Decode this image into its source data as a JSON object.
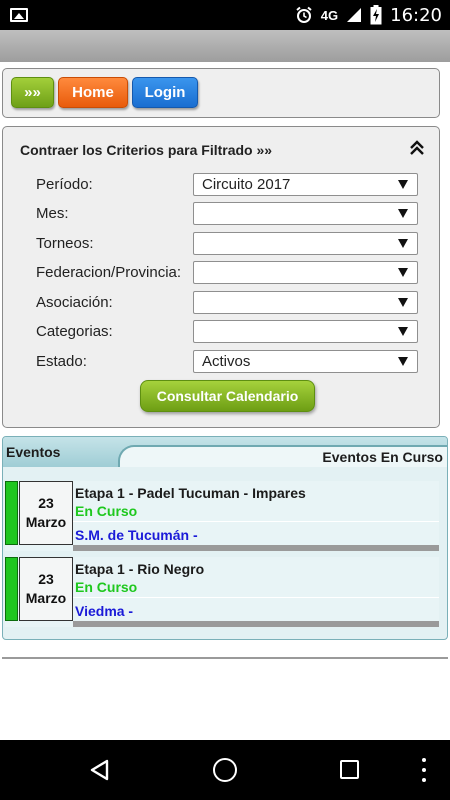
{
  "status_bar": {
    "network": "4G",
    "time": "16:20",
    "icons": [
      "image-icon",
      "alarm-icon",
      "signal-icon",
      "battery-charging-icon"
    ]
  },
  "nav": {
    "more_label": "»»",
    "home_label": "Home",
    "login_label": "Login"
  },
  "filter": {
    "title": "Contraer los Criterios para Filtrado »»",
    "fields": [
      {
        "label": "Período:",
        "value": "Circuito 2017"
      },
      {
        "label": "Mes:",
        "value": ""
      },
      {
        "label": "Torneos:",
        "value": ""
      },
      {
        "label": "Federacion/Provincia:",
        "value": ""
      },
      {
        "label": "Asociación:",
        "value": ""
      },
      {
        "label": "Categorias:",
        "value": ""
      },
      {
        "label": "Estado:",
        "value": "Activos"
      }
    ],
    "submit_label": "Consultar Calendario"
  },
  "events": {
    "title": "Eventos",
    "subtitle": "Eventos En Curso",
    "items": [
      {
        "day": "23",
        "month": "Marzo",
        "title": "Etapa 1 - Padel Tucuman - Impares",
        "status": "En Curso",
        "place": "S.M. de Tucumán -"
      },
      {
        "day": "23",
        "month": "Marzo",
        "title": "Etapa 1 - Rio Negro",
        "status": "En Curso",
        "place": "Viedma -"
      }
    ]
  },
  "colors": {
    "accent_green": "#7ab322",
    "home_orange": "#f2711c",
    "login_blue": "#2a82e0",
    "status_green": "#1ec81e",
    "place_blue": "#1a1ad8"
  }
}
